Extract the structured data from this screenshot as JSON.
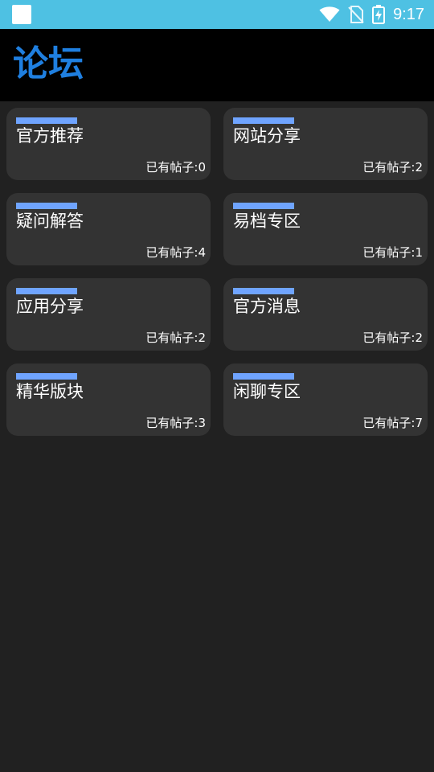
{
  "status_bar": {
    "time": "9:17",
    "icons": [
      "app-notification-icon",
      "wifi-icon",
      "no-sim-icon",
      "battery-charging-icon"
    ],
    "background_color": "#4ec1e3"
  },
  "app_bar": {
    "title": "论坛",
    "title_color": "#1f7fe0"
  },
  "colors": {
    "card_background": "#333333",
    "card_accent": "#6fa4ff",
    "page_background": "#212121"
  },
  "forums": [
    {
      "name": "官方推荐",
      "count_label": "已有帖子:0"
    },
    {
      "name": "网站分享",
      "count_label": "已有帖子:2"
    },
    {
      "name": "疑问解答",
      "count_label": "已有帖子:4"
    },
    {
      "name": "易档专区",
      "count_label": "已有帖子:1"
    },
    {
      "name": "应用分享",
      "count_label": "已有帖子:2"
    },
    {
      "name": "官方消息",
      "count_label": "已有帖子:2"
    },
    {
      "name": "精华版块",
      "count_label": "已有帖子:3"
    },
    {
      "name": "闲聊专区",
      "count_label": "已有帖子:7"
    }
  ]
}
